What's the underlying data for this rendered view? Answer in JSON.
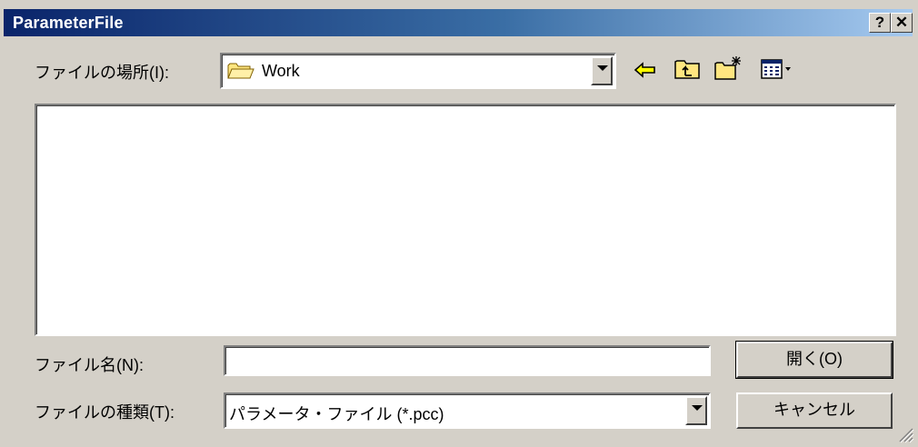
{
  "window": {
    "title": "ParameterFile",
    "help_label": "?",
    "close_label": "✕"
  },
  "look_in": {
    "label": "ファイルの場所(I):",
    "value": "Work",
    "folder_icon": "folder-icon"
  },
  "toolbar": {
    "back_icon": "back-arrow-icon",
    "up_icon": "up-one-level-icon",
    "new_folder_icon": "new-folder-icon",
    "view_menu_icon": "view-menu-icon"
  },
  "file_name": {
    "label": "ファイル名(N):",
    "value": ""
  },
  "file_type": {
    "label": "ファイルの種類(T):",
    "value": "パラメータ・ファイル (*.pcc)"
  },
  "buttons": {
    "open_label": "開く(O)",
    "cancel_label": "キャンセル"
  }
}
